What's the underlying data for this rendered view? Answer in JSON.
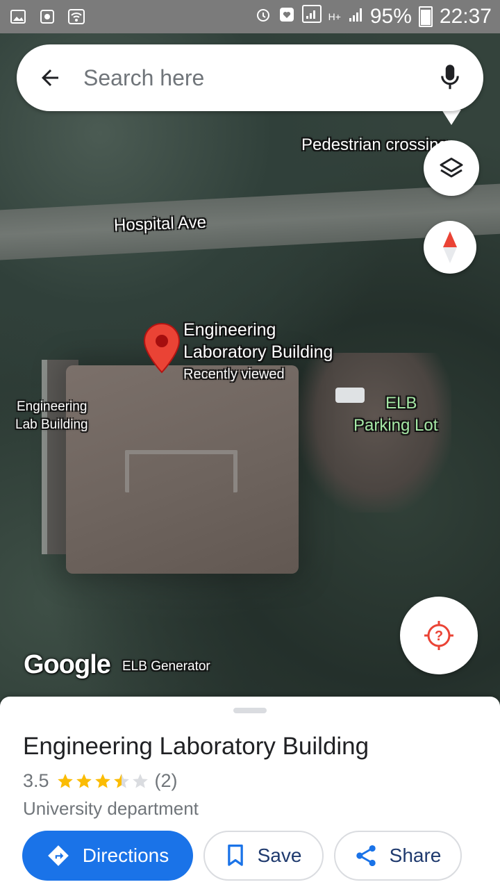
{
  "status_bar": {
    "battery": "95%",
    "time": "22:37",
    "network": "H+"
  },
  "search": {
    "placeholder": "Search here"
  },
  "map": {
    "labels": {
      "pedestrian": "Pedestrian crossing",
      "street": "Hospital Ave",
      "pin_title_line1": "Engineering",
      "pin_title_line2": "Laboratory Building",
      "pin_subtitle": "Recently viewed",
      "side_building_line1": "Engineering",
      "side_building_line2": "Lab Building",
      "parking_line1": "ELB",
      "parking_line2": "Parking Lot",
      "attribution": "ELB Generator"
    },
    "logo": "Google"
  },
  "place": {
    "title": "Engineering Laboratory Building",
    "rating": "3.5",
    "rating_value": 3.5,
    "reviews": "(2)",
    "category": "University department"
  },
  "actions": {
    "directions": "Directions",
    "save": "Save",
    "share": "Share"
  },
  "colors": {
    "accent": "#1a73e8",
    "star": "#fbbc04",
    "pin": "#ea4335"
  }
}
